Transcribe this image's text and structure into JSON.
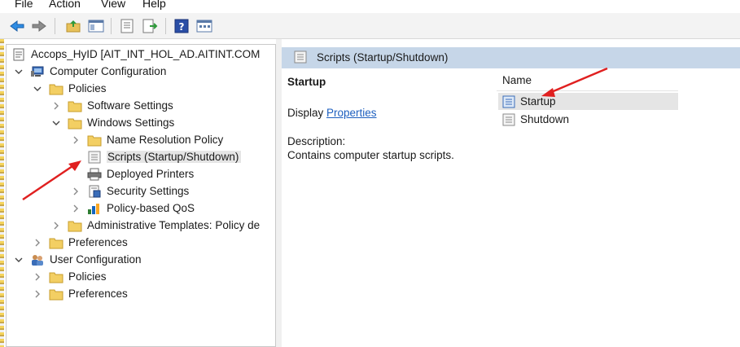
{
  "menu": {
    "items": [
      "File",
      "Action",
      "View",
      "Help"
    ]
  },
  "toolbar": {
    "buttons": [
      "back-icon",
      "forward-icon",
      "up-folder-icon",
      "show-hide-tree-icon",
      "properties-icon",
      "export-list-icon",
      "help-icon",
      "console-view-icon"
    ]
  },
  "tree": {
    "root": "Accops_HyID [AIT_INT_HOL_AD.AITINT.COM",
    "computer_configuration": "Computer Configuration",
    "policies": "Policies",
    "software_settings": "Software Settings",
    "windows_settings": "Windows Settings",
    "name_resolution_policy": "Name Resolution Policy",
    "scripts": "Scripts (Startup/Shutdown)",
    "deployed_printers": "Deployed Printers",
    "security_settings": "Security Settings",
    "policy_based_qos": "Policy-based QoS",
    "administrative_templates": "Administrative Templates: Policy de",
    "preferences": "Preferences",
    "user_configuration": "User Configuration",
    "user_policies": "Policies",
    "user_preferences": "Preferences"
  },
  "details": {
    "header": "Scripts (Startup/Shutdown)",
    "title": "Startup",
    "display_prefix": "Display ",
    "display_link": "Properties",
    "description_label": "Description:",
    "description_text": "Contains computer startup scripts."
  },
  "list": {
    "column_name": "Name",
    "items": [
      "Startup",
      "Shutdown"
    ]
  },
  "colors": {
    "header_band": "#c6d6e8",
    "annotation_arrow": "#e02020",
    "link": "#1d5fbf",
    "selection": "#e5e5e5"
  }
}
